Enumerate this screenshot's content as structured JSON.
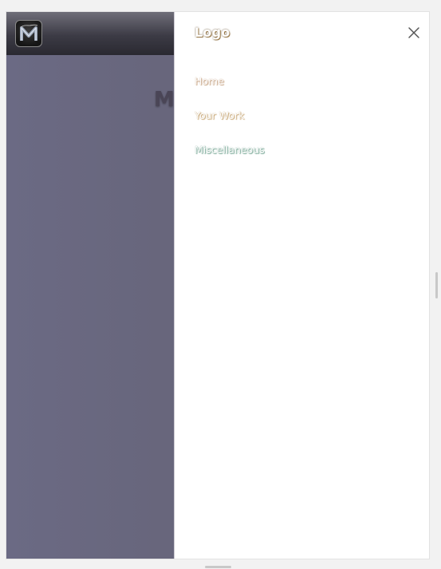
{
  "page": {
    "hero_title": "Mi"
  },
  "drawer": {
    "logo": "Logo",
    "close_icon": "close-icon",
    "menu": [
      {
        "label": "Home"
      },
      {
        "label": "Your Work"
      },
      {
        "label": "Miscellaneous"
      }
    ]
  },
  "colors": {
    "page_background": "#666478",
    "header_background": "#3c3b45",
    "drawer_background": "#ffffff",
    "home_glow": "#c29c78",
    "work_glow": "#c6a26c",
    "misc_glow": "#6fa390"
  }
}
